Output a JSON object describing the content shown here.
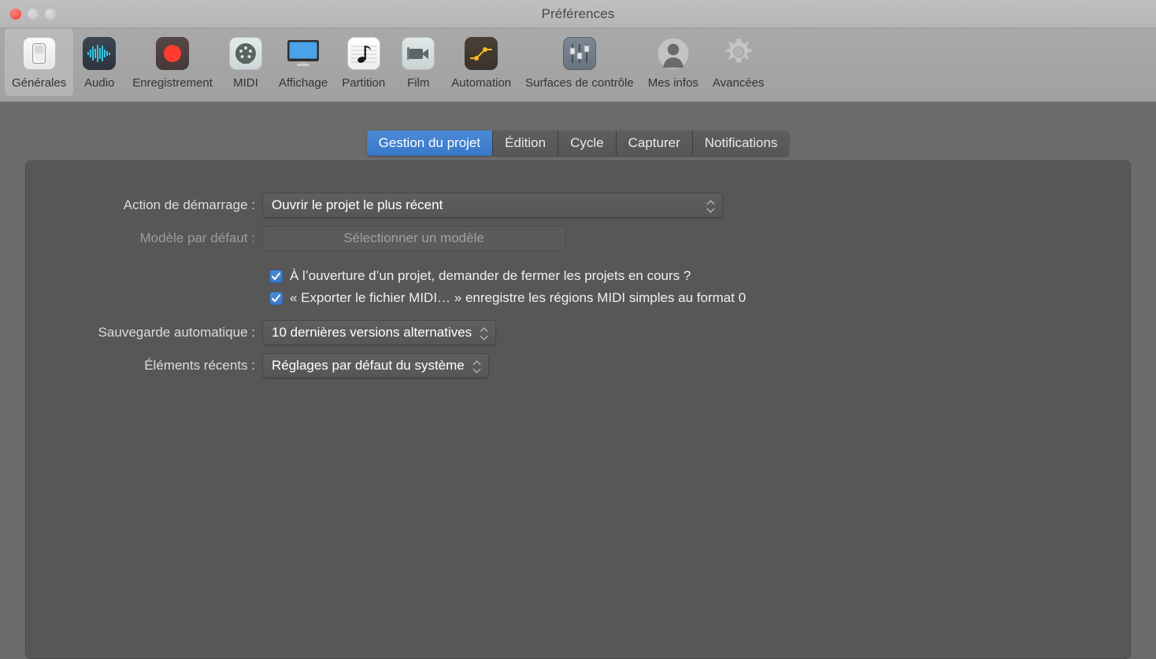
{
  "window": {
    "title": "Préférences",
    "traffic_lights": [
      "close",
      "minimize",
      "zoom"
    ],
    "accent_blue": "#3d7fd4",
    "panel_bg": "#575757",
    "backdrop_bg": "#6b6b6b",
    "titlebar_bg": "#b8b8b8"
  },
  "toolbar": {
    "items": [
      {
        "label": "Générales",
        "icon": "switch-icon",
        "selected": true
      },
      {
        "label": "Audio",
        "icon": "waveform-icon",
        "selected": false
      },
      {
        "label": "Enregistrement",
        "icon": "record-icon",
        "selected": false
      },
      {
        "label": "MIDI",
        "icon": "midi-din-icon",
        "selected": false
      },
      {
        "label": "Affichage",
        "icon": "display-monitor-icon",
        "selected": false
      },
      {
        "label": "Partition",
        "icon": "music-note-icon",
        "selected": false
      },
      {
        "label": "Film",
        "icon": "video-camera-icon",
        "selected": false
      },
      {
        "label": "Automation",
        "icon": "automation-curve-icon",
        "selected": false
      },
      {
        "label": "Surfaces de contrôle",
        "icon": "faders-icon",
        "selected": false
      },
      {
        "label": "Mes infos",
        "icon": "user-avatar-icon",
        "selected": false
      },
      {
        "label": "Avancées",
        "icon": "gear-icon",
        "selected": false
      }
    ]
  },
  "tabs": [
    {
      "label": "Gestion du projet",
      "active": true
    },
    {
      "label": "Édition",
      "active": false
    },
    {
      "label": "Cycle",
      "active": false
    },
    {
      "label": "Capturer",
      "active": false
    },
    {
      "label": "Notifications",
      "active": false
    }
  ],
  "form": {
    "startup_action": {
      "label": "Action de démarrage :",
      "value": "Ouvrir le projet le plus récent",
      "enabled": true
    },
    "default_template": {
      "label": "Modèle par défaut :",
      "value": "Sélectionner un modèle",
      "enabled": false
    },
    "checkbox_close_projects": {
      "label": "À l’ouverture d’un projet, demander de fermer les projets en cours ?",
      "checked": true
    },
    "checkbox_midi_format0": {
      "label": "« Exporter le fichier MIDI… » enregistre les régions MIDI simples au format 0",
      "checked": true
    },
    "autosave": {
      "label": "Sauvegarde automatique :",
      "value": "10 dernières versions alternatives",
      "enabled": true
    },
    "recent_items": {
      "label": "Éléments récents :",
      "value": "Réglages par défaut du système",
      "enabled": true
    }
  }
}
